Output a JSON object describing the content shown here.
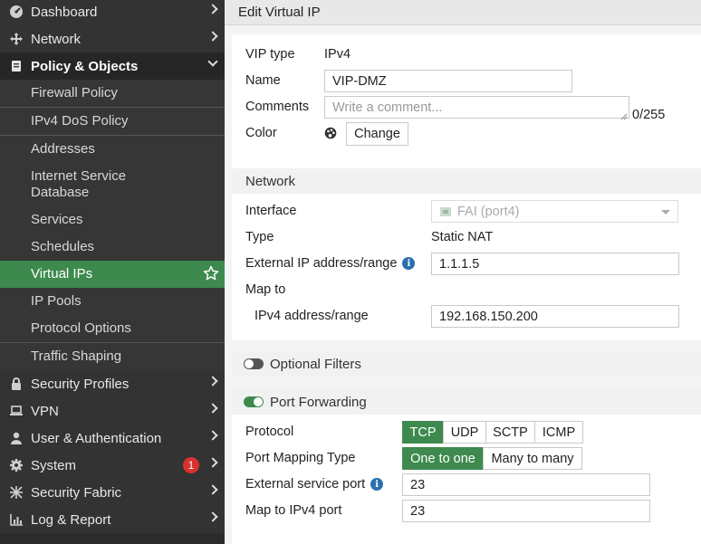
{
  "sidebar": {
    "items": [
      {
        "label": "Dashboard",
        "icon": "dashboard-icon"
      },
      {
        "label": "Network",
        "icon": "network-move-icon"
      },
      {
        "label": "Policy & Objects",
        "icon": "policy-icon"
      },
      {
        "label": "Security Profiles",
        "icon": "lock-icon"
      },
      {
        "label": "VPN",
        "icon": "laptop-icon"
      },
      {
        "label": "User & Authentication",
        "icon": "user-icon"
      },
      {
        "label": "System",
        "icon": "gear-icon",
        "badge": "1"
      },
      {
        "label": "Security Fabric",
        "icon": "fabric-icon"
      },
      {
        "label": "Log & Report",
        "icon": "chart-icon"
      }
    ],
    "sub_items": [
      "Firewall Policy",
      "IPv4 DoS Policy",
      "Addresses",
      "Internet Service\nDatabase",
      "Services",
      "Schedules",
      "Virtual IPs",
      "IP Pools",
      "Protocol Options",
      "Traffic Shaping"
    ],
    "active_sub": "Virtual IPs"
  },
  "header": {
    "title": "Edit Virtual IP"
  },
  "form": {
    "vip_type_label": "VIP type",
    "vip_type_value": "IPv4",
    "name_label": "Name",
    "name_value": "VIP-DMZ",
    "comments_label": "Comments",
    "comments_placeholder": "Write a comment...",
    "comments_counter": "0/255",
    "color_label": "Color",
    "change_button": "Change"
  },
  "network": {
    "section_title": "Network",
    "interface_label": "Interface",
    "interface_value": "FAI (port4)",
    "type_label": "Type",
    "type_value": "Static NAT",
    "ext_ip_label": "External IP address/range",
    "ext_ip_value": "1.1.1.5",
    "map_to_label": "Map to",
    "ipv4_range_label": "IPv4 address/range",
    "ipv4_range_value": "192.168.150.200"
  },
  "optional_filters": {
    "label": "Optional Filters",
    "enabled": false
  },
  "port_forwarding": {
    "label": "Port Forwarding",
    "enabled": true,
    "protocol_label": "Protocol",
    "protocols": [
      "TCP",
      "UDP",
      "SCTP",
      "ICMP"
    ],
    "protocol_selected": "TCP",
    "mapping_type_label": "Port Mapping Type",
    "mapping_types": [
      "One to one",
      "Many to many"
    ],
    "mapping_selected": "One to one",
    "ext_port_label": "External service port",
    "ext_port_value": "23",
    "map_port_label": "Map to IPv4 port",
    "map_port_value": "23"
  },
  "colors": {
    "accent_green": "#3e8a4e",
    "sidebar_bg": "#2b2b2b",
    "badge_red": "#d9322e",
    "info_blue": "#2a6fb0"
  }
}
